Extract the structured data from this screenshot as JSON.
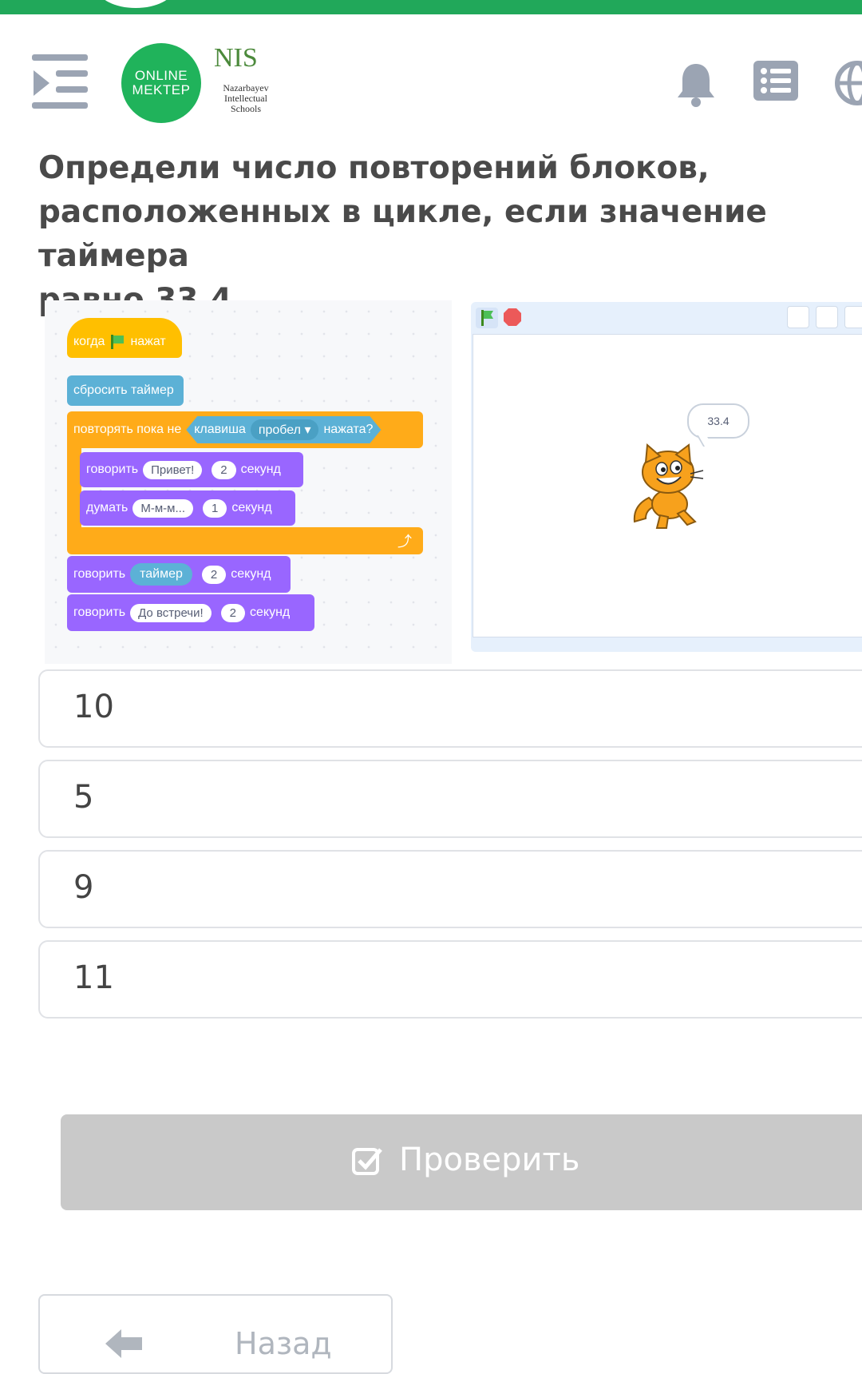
{
  "header": {
    "logo_online": "ONLINE",
    "logo_mektep": "MEKTEP",
    "nis_mark": "NIS",
    "nis_line1": "Nazarbayev",
    "nis_line2": "Intellectual",
    "nis_line3": "Schools"
  },
  "question": "Определи число повторений блоков,\nрасположенных в цикле, если значение таймера\nравно 33.4.",
  "code": {
    "when_prefix": "когда",
    "when_suffix": "нажат",
    "reset_timer": "сбросить таймер",
    "repeat_until": "повторять пока не",
    "key_label": "клавиша",
    "key_value": "пробел ▾",
    "pressed": "нажата?",
    "say1_label": "говорить",
    "say1_text": "Привет!",
    "say1_secs": "2",
    "say1_unit": "секунд",
    "think_label": "думать",
    "think_text": "М-м-м...",
    "think_secs": "1",
    "think_unit": "секунд",
    "loop_arrow": "⤴",
    "say2_label": "говорить",
    "say2_reporter": "таймер",
    "say2_secs": "2",
    "say2_unit": "секунд",
    "say3_label": "говорить",
    "say3_text": "До встречи!",
    "say3_secs": "2",
    "say3_unit": "секунд"
  },
  "stage": {
    "bubble_text": "33.4"
  },
  "answers": [
    {
      "label": "10"
    },
    {
      "label": "5"
    },
    {
      "label": "9"
    },
    {
      "label": "11"
    }
  ],
  "check_button": "Проверить",
  "back_button": "Назад",
  "colors": {
    "brand_green": "#21a85a",
    "scratch_events": "#ffbf00",
    "scratch_sensing": "#5cb1d6",
    "scratch_control": "#ffab19",
    "scratch_looks": "#9966ff",
    "button_disabled": "#c9c9c9"
  }
}
